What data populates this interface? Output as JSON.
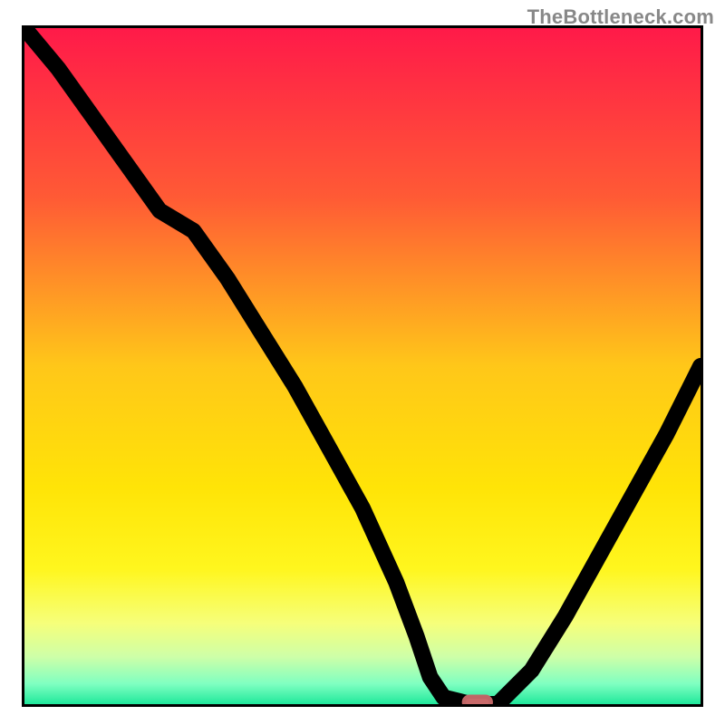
{
  "watermark": {
    "text": "TheBottleneck.com"
  },
  "chart_data": {
    "type": "line",
    "title": "",
    "xlabel": "",
    "ylabel": "",
    "xlim": [
      0,
      100
    ],
    "ylim": [
      0,
      100
    ],
    "grid": false,
    "legend": false,
    "background_gradient": {
      "direction": "vertical",
      "stops": [
        {
          "pos": 0.0,
          "color": "#ff1a49"
        },
        {
          "pos": 0.25,
          "color": "#ff5a35"
        },
        {
          "pos": 0.5,
          "color": "#ffc719"
        },
        {
          "pos": 0.68,
          "color": "#ffe407"
        },
        {
          "pos": 0.8,
          "color": "#fff61e"
        },
        {
          "pos": 0.88,
          "color": "#f6ff7a"
        },
        {
          "pos": 0.93,
          "color": "#ceffa8"
        },
        {
          "pos": 0.97,
          "color": "#7fffc1"
        },
        {
          "pos": 1.0,
          "color": "#20e89b"
        }
      ]
    },
    "series": [
      {
        "name": "bottleneck-curve",
        "type": "line",
        "x": [
          0,
          5,
          10,
          15,
          20,
          25,
          30,
          35,
          40,
          45,
          50,
          55,
          58,
          60,
          62,
          66,
          70,
          75,
          80,
          85,
          90,
          95,
          100
        ],
        "y": [
          100,
          94,
          87,
          80,
          73,
          70,
          63,
          55,
          47,
          38,
          29,
          18,
          10,
          4,
          1,
          0,
          0,
          5,
          13,
          22,
          31,
          40,
          50
        ]
      }
    ],
    "marker": {
      "name": "optimal-point",
      "shape": "rounded-rect",
      "x": 67,
      "y": 0,
      "color": "#c96a6a",
      "width_pct": 4.0,
      "height_pct": 1.6
    }
  }
}
